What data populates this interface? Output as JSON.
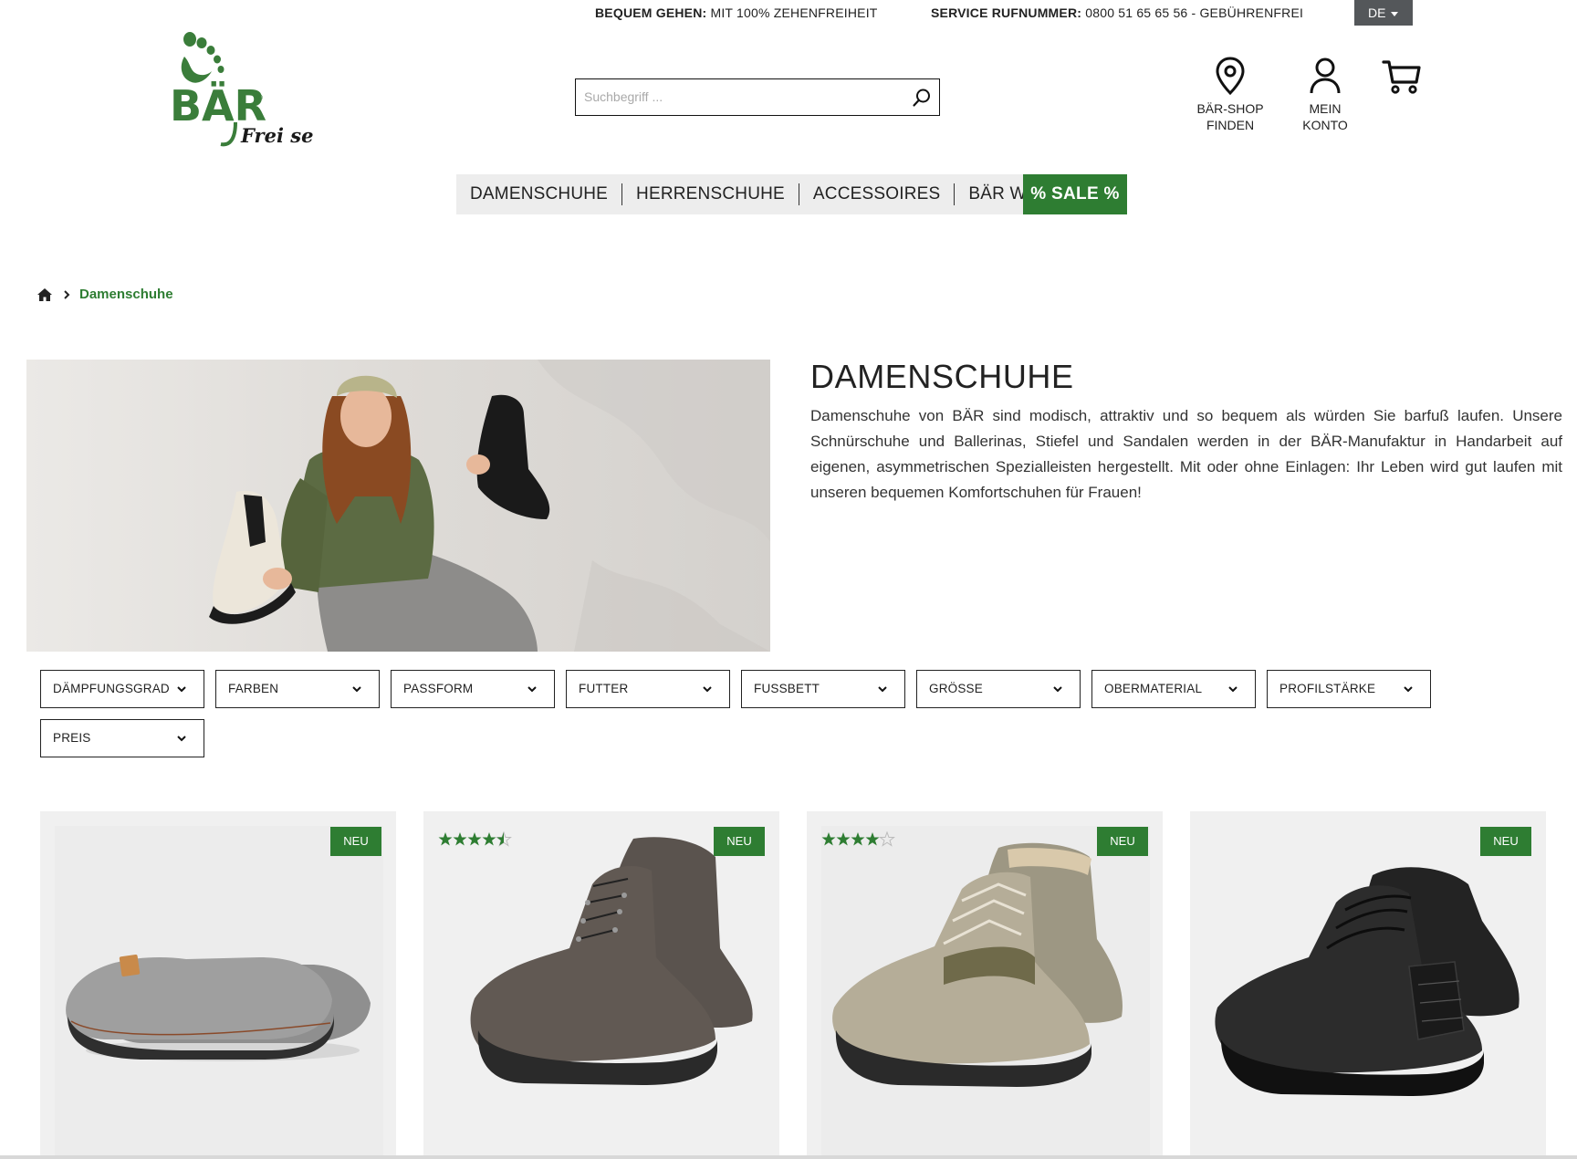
{
  "topbar": {
    "usp_bold": "BEQUEM GEHEN:",
    "usp_text": " MIT 100% ZEHENFREIHEIT",
    "service_bold": "SERVICE RUFNUMMER:",
    "service_text": " 0800 51 65 65 56 - GEBÜHRENFREI",
    "language": "DE"
  },
  "logo": {
    "brand": "BÄR",
    "tagline": "Frei sein"
  },
  "search": {
    "placeholder": "Suchbegriff ..."
  },
  "header_icons": {
    "shop_finder": "BÄR-SHOP FINDEN",
    "shop_finder_line1": "BÄR-SHOP",
    "shop_finder_line2": "FINDEN",
    "account_line1": "MEIN",
    "account_line2": "KONTO"
  },
  "nav": {
    "items": [
      "DAMENSCHUHE",
      "HERRENSCHUHE",
      "ACCESSOIRES",
      "BÄR WELT"
    ],
    "sale": "% SALE %"
  },
  "breadcrumb": {
    "current": "Damenschuhe"
  },
  "category": {
    "title": "DAMENSCHUHE",
    "description": "Damenschuhe von BÄR sind modisch, attraktiv und so bequem als würden Sie barfuß laufen. Unsere Schnürschuhe und Ballerinas, Stiefel und Sandalen werden in der BÄR-Manufaktur in Handarbeit auf eigenen, asymmetrischen Spezialleisten hergestellt. Mit oder ohne Einlagen: Ihr Leben wird gut laufen mit unseren bequemen Komfortschuhen für Frauen!"
  },
  "filters": [
    "DÄMPFUNGSGRAD",
    "FARBEN",
    "PASSFORM",
    "FUTTER",
    "FUSSBETT",
    "GRÖSSE",
    "OBERMATERIAL",
    "PROFILSTÄRKE",
    "PREIS"
  ],
  "products": [
    {
      "badge": "NEU",
      "rating": null,
      "image": "grey-felt-slipper"
    },
    {
      "badge": "NEU",
      "rating": 4.5,
      "image": "dark-grey-lace-up-boot"
    },
    {
      "badge": "NEU",
      "rating": 4.0,
      "image": "beige-lined-winter-boot"
    },
    {
      "badge": "NEU",
      "rating": null,
      "image": "black-leather-hiking-boot"
    }
  ],
  "colors": {
    "brand_green": "#2e7d32",
    "nav_bg": "#ededed",
    "card_bg": "#f0f0f0",
    "lang_bg": "#54575a"
  }
}
